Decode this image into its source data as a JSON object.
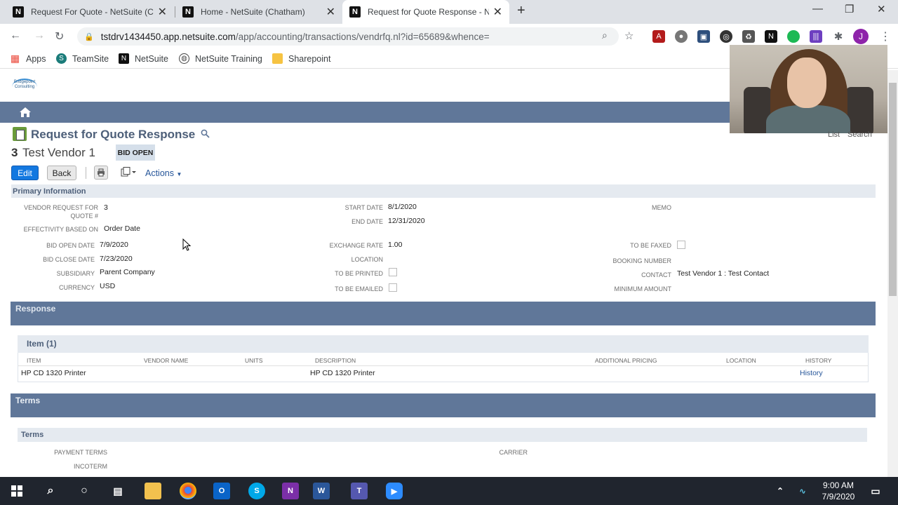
{
  "browser": {
    "tabs": [
      {
        "title": "Request For Quote - NetSuite (Cl",
        "active": false
      },
      {
        "title": "Home - NetSuite (Chatham)",
        "active": false
      },
      {
        "title": "Request for Quote Response - N",
        "active": true
      }
    ],
    "url_host": "tstdrv1434450.app.netsuite.com",
    "url_path": "/app/accounting/transactions/vendrfq.nl?id=65689&whence=",
    "profile_initial": "J",
    "bookmarks": [
      "Apps",
      "TeamSite",
      "NetSuite",
      "NetSuite Training",
      "Sharepoint"
    ]
  },
  "header": {
    "logo_text": "Bridgepoint Consulting",
    "list_label": "List",
    "search_label": "Search"
  },
  "record": {
    "page_title": "Request for Quote Response",
    "number": "3",
    "name": "Test Vendor 1",
    "status": "BID OPEN",
    "edit_label": "Edit",
    "back_label": "Back",
    "actions_label": "Actions"
  },
  "primary": {
    "heading": "Primary Information",
    "vendor_request_label_1": "VENDOR REQUEST FOR",
    "vendor_request_label_2": "QUOTE #",
    "vendor_request_value": "3",
    "effectivity_label": "EFFECTIVITY BASED ON",
    "effectivity_value": "Order Date",
    "bid_open_label": "BID OPEN DATE",
    "bid_open_value": "7/9/2020",
    "bid_close_label": "BID CLOSE DATE",
    "bid_close_value": "7/23/2020",
    "subsidiary_label": "SUBSIDIARY",
    "subsidiary_value": "Parent Company",
    "currency_label": "CURRENCY",
    "currency_value": "USD",
    "start_date_label": "START DATE",
    "start_date_value": "8/1/2020",
    "end_date_label": "END DATE",
    "end_date_value": "12/31/2020",
    "exchange_rate_label": "EXCHANGE RATE",
    "exchange_rate_value": "1.00",
    "location_label": "LOCATION",
    "to_be_printed_label": "TO BE PRINTED",
    "to_be_emailed_label": "TO BE EMAILED",
    "memo_label": "MEMO",
    "to_be_faxed_label": "TO BE FAXED",
    "booking_number_label": "BOOKING NUMBER",
    "contact_label": "CONTACT",
    "contact_value": "Test Vendor 1 : Test Contact",
    "minimum_amount_label": "MINIMUM AMOUNT"
  },
  "response": {
    "heading": "Response",
    "items_tab": "Item (1)",
    "columns": [
      "ITEM",
      "VENDOR NAME",
      "UNITS",
      "DESCRIPTION",
      "ADDITIONAL PRICING",
      "LOCATION",
      "HISTORY"
    ],
    "rows": [
      {
        "item": "HP CD 1320 Printer",
        "vendor_name": "",
        "units": "",
        "description": "HP CD 1320 Printer",
        "additional_pricing": "",
        "location": "",
        "history": "History"
      }
    ]
  },
  "terms": {
    "heading": "Terms",
    "sub_heading": "Terms",
    "payment_terms_label": "PAYMENT TERMS",
    "incoterm_label": "INCOTERM",
    "carrier_label": "CARRIER"
  },
  "taskbar": {
    "time": "9:00 AM",
    "date": "7/9/2020"
  },
  "colors": {
    "nav_bar": "#607799",
    "section_header": "#607799",
    "edit_button": "#1378e0",
    "link": "#255599"
  }
}
